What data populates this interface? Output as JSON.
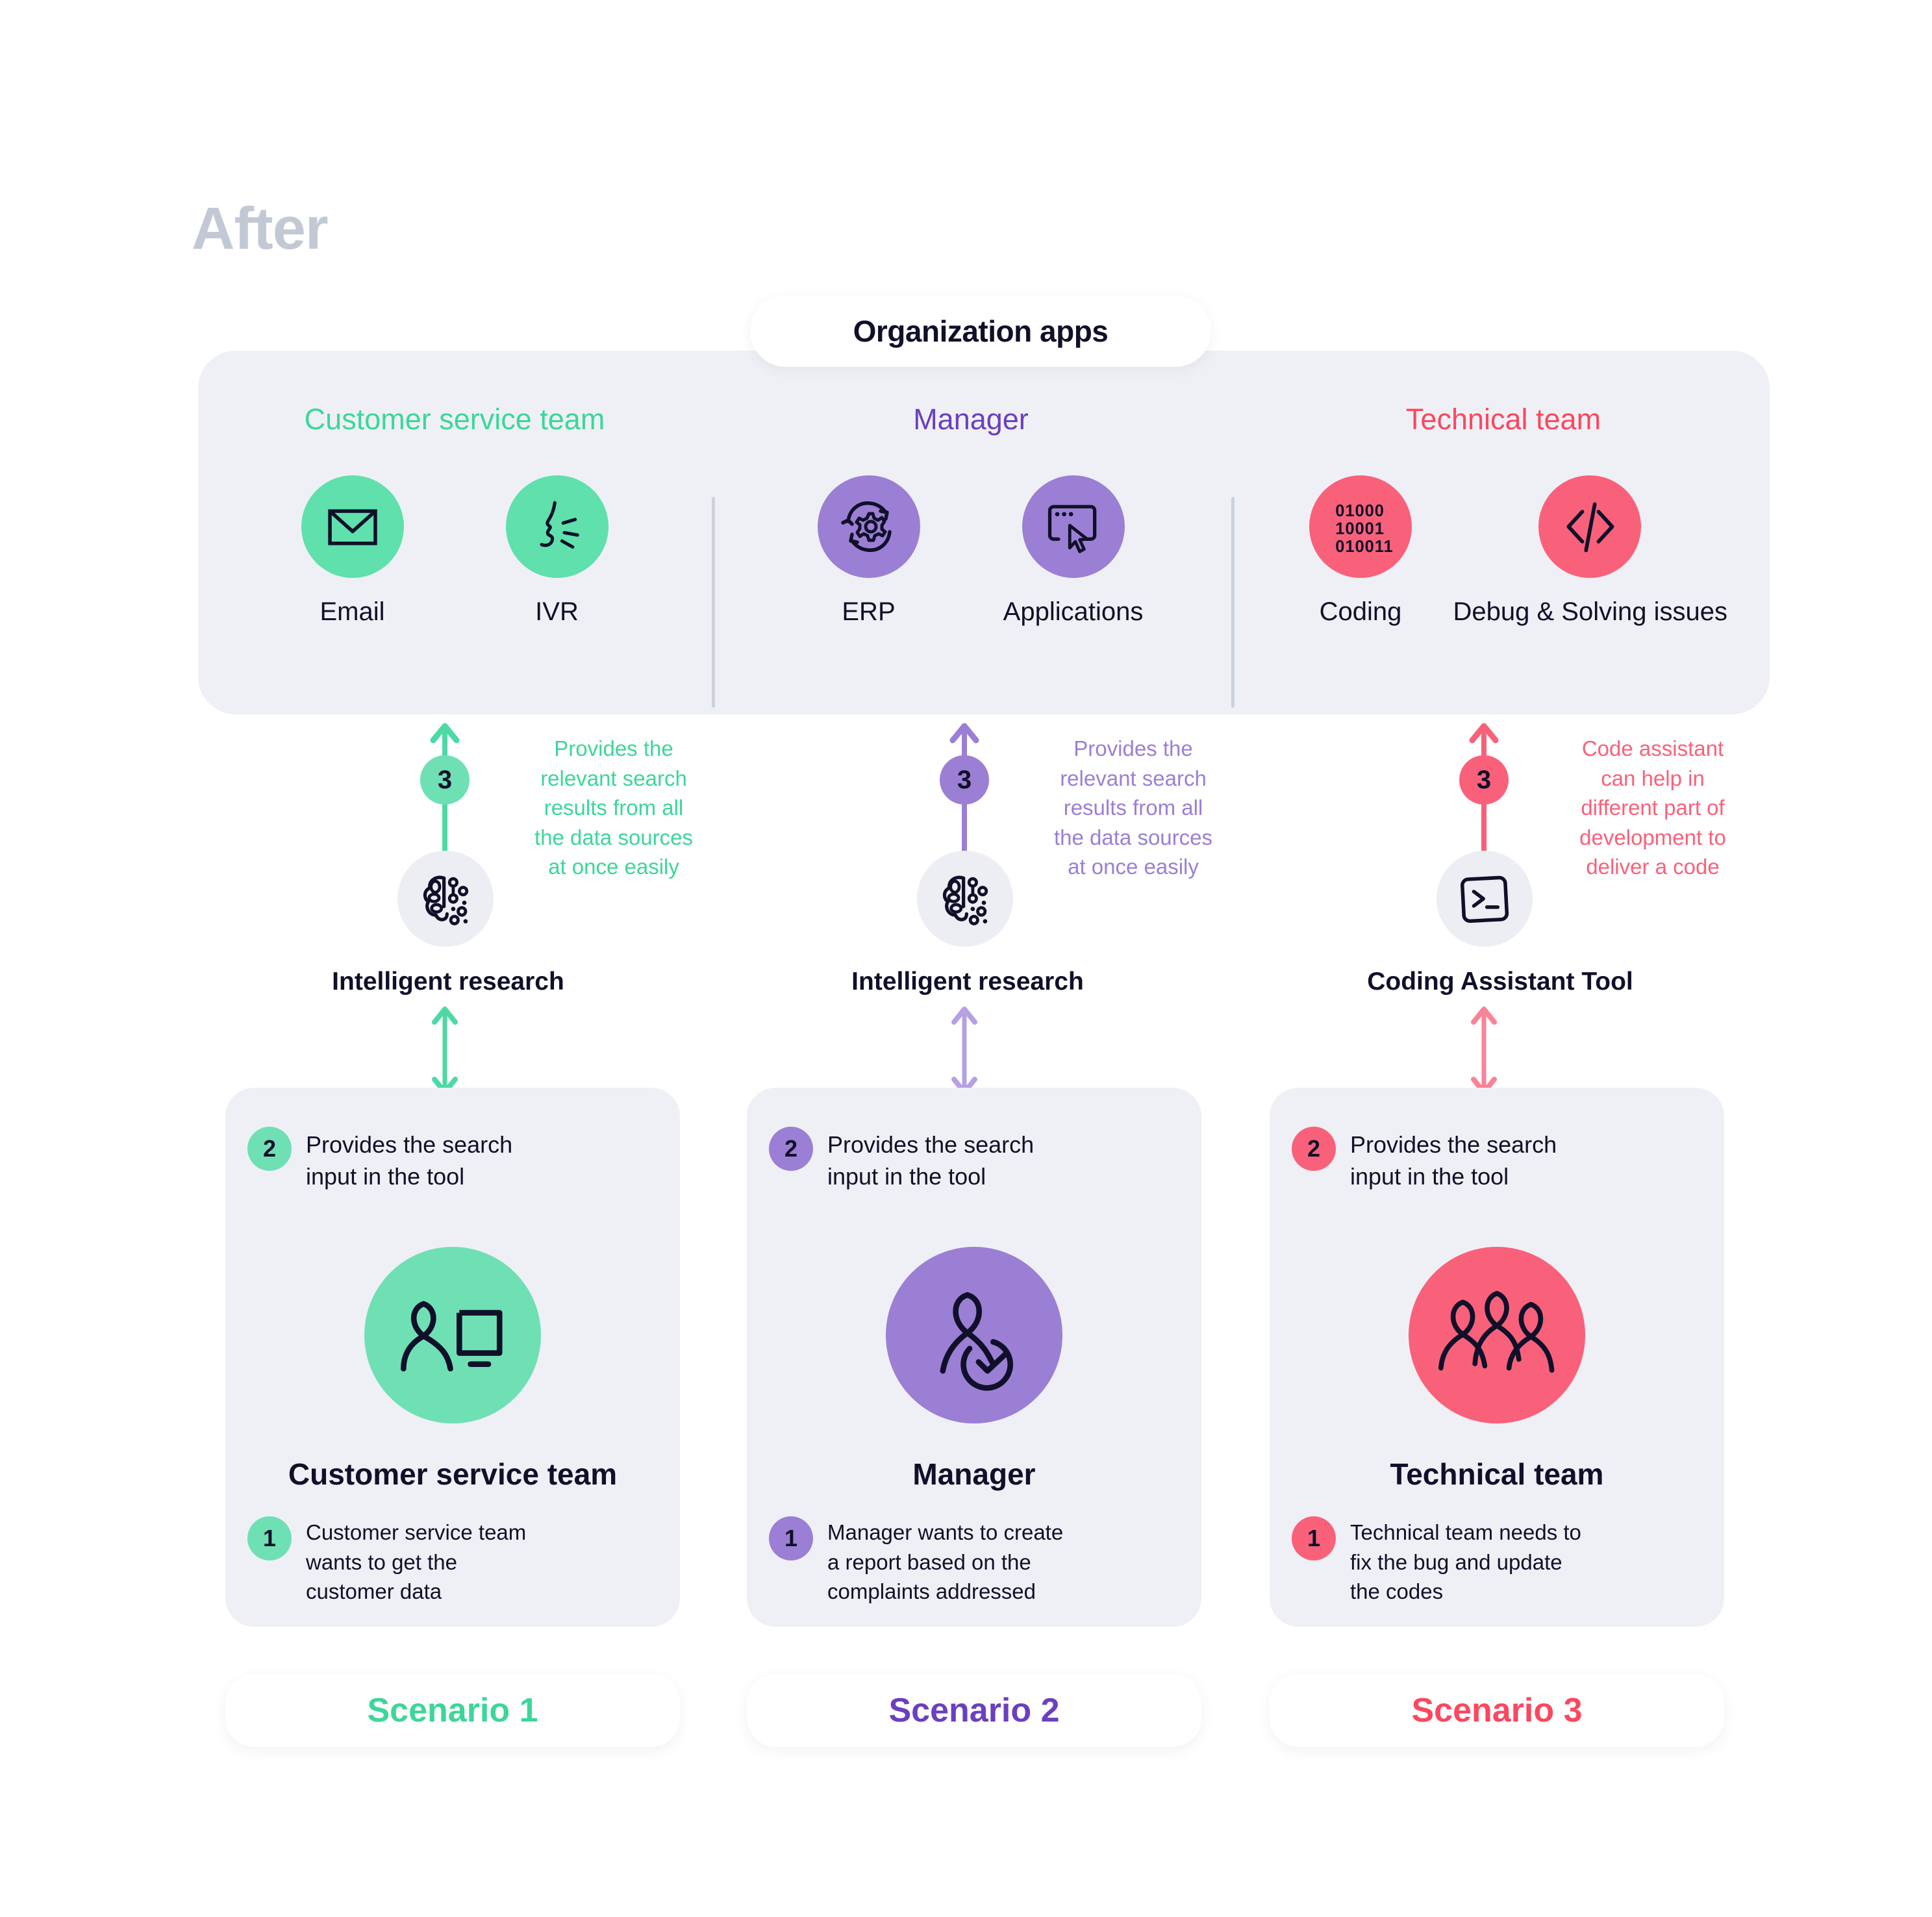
{
  "title": "After",
  "org_panel": {
    "badge_label": "Organization apps"
  },
  "colors": {
    "green": "#5FE0AC",
    "green_text": "#3DD699",
    "purple": "#9B7FD4",
    "purple_text": "#6B3FBE",
    "red": "#F9617A",
    "red_text": "#F9485F",
    "panel_bg": "#EFF0F5",
    "ink": "#10102A",
    "title_gray": "#C3C9D4"
  },
  "teams": [
    {
      "name": "Customer service team",
      "accent": "green",
      "apps": [
        {
          "label": "Email",
          "icon": "envelope-icon"
        },
        {
          "label": "IVR",
          "icon": "speaking-face-icon"
        }
      ],
      "step3": {
        "number": "3",
        "text": "Provides the\nrelevant search\nresults from all\nthe data sources\nat once easily"
      },
      "tool": {
        "label": "Intelligent research",
        "icon": "brain-ai-icon"
      },
      "scenario": {
        "step2_number": "2",
        "step2_text": "Provides the search\ninput in the tool",
        "role": "Customer service team",
        "role_icon": "person-with-monitor-icon",
        "step1_number": "1",
        "step1_text": "Customer service team\nwants to get the\ncustomer data",
        "pill_label": "Scenario 1"
      }
    },
    {
      "name": "Manager",
      "accent": "purple",
      "apps": [
        {
          "label": "ERP",
          "icon": "gear-cycle-icon"
        },
        {
          "label": "Applications",
          "icon": "window-cursor-icon"
        }
      ],
      "step3": {
        "number": "3",
        "text": "Provides the\nrelevant search\nresults from all\nthe data sources\nat once easily"
      },
      "tool": {
        "label": "Intelligent research",
        "icon": "brain-ai-icon"
      },
      "scenario": {
        "step2_number": "2",
        "step2_text": "Provides the search\ninput in the tool",
        "role": "Manager",
        "role_icon": "person-with-check-icon",
        "step1_number": "1",
        "step1_text": "Manager wants to create\na report based on the\ncomplaints addressed",
        "pill_label": "Scenario 2"
      }
    },
    {
      "name": "Technical team",
      "accent": "red",
      "apps": [
        {
          "label": "Coding",
          "icon": "binary-code-icon"
        },
        {
          "label": "Debug & Solving issues",
          "icon": "code-brackets-icon"
        }
      ],
      "step3": {
        "number": "3",
        "text": "Code assistant\ncan help in\ndifferent part of\ndevelopment to\ndeliver a code"
      },
      "tool": {
        "label": "Coding Assistant Tool",
        "icon": "terminal-prompt-icon"
      },
      "scenario": {
        "step2_number": "2",
        "step2_text": "Provides the search\ninput in the tool",
        "role": "Technical team",
        "role_icon": "three-people-icon",
        "step1_number": "1",
        "step1_text": "Technical team needs to\nfix the bug and update\nthe codes",
        "pill_label": "Scenario 3"
      }
    }
  ]
}
